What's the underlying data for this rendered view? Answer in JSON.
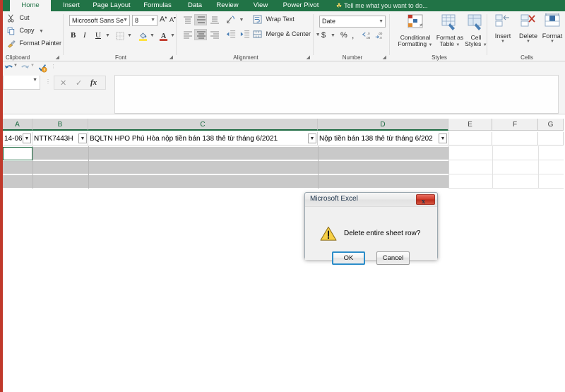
{
  "window": {
    "app_name": "Microsoft Excel"
  },
  "ribbon": {
    "tabs": [
      {
        "label": "Home",
        "active": true
      },
      {
        "label": "Insert",
        "active": false
      },
      {
        "label": "Page Layout",
        "active": false
      },
      {
        "label": "Formulas",
        "active": false
      },
      {
        "label": "Data",
        "active": false
      },
      {
        "label": "Review",
        "active": false
      },
      {
        "label": "View",
        "active": false
      },
      {
        "label": "Power Pivot",
        "active": false
      }
    ],
    "tell_me": "Tell me what you want to do...",
    "groups": {
      "clipboard": {
        "label": "Clipboard",
        "cut": "Cut",
        "copy": "Copy",
        "format_painter": "Format Painter"
      },
      "font": {
        "label": "Font",
        "font_name": "Microsoft Sans Se",
        "font_size": "8",
        "bold": "B",
        "italic": "I",
        "underline": "U",
        "grow_font": "A",
        "shrink_font": "A"
      },
      "alignment": {
        "label": "Alignment",
        "wrap_text": "Wrap Text",
        "merge_center": "Merge & Center"
      },
      "number": {
        "label": "Number",
        "format_value": "Date",
        "currency": "$",
        "percent": "%",
        "comma": ","
      },
      "styles": {
        "label": "Styles",
        "conditional_formatting": "Conditional\nFormatting",
        "conditional_formatting_l1": "Conditional",
        "conditional_formatting_l2": "Formatting",
        "format_as_table_l1": "Format as",
        "format_as_table_l2": "Table",
        "cell_styles_l1": "Cell",
        "cell_styles_l2": "Styles"
      },
      "cells": {
        "label": "Cells",
        "insert": "Insert",
        "delete": "Delete",
        "format": "Format"
      }
    }
  },
  "formula_bar": {
    "name_box_value": "",
    "formula_value": "",
    "cancel_icon": "cancel-icon",
    "enter_icon": "enter-icon",
    "fx_label": "fx"
  },
  "sheet": {
    "columns": [
      {
        "label": "A",
        "selected": true
      },
      {
        "label": "B",
        "selected": true
      },
      {
        "label": "C",
        "selected": true
      },
      {
        "label": "D",
        "selected": true
      },
      {
        "label": "E",
        "selected": false
      },
      {
        "label": "F",
        "selected": false
      },
      {
        "label": "G",
        "selected": false
      }
    ],
    "header_row": {
      "a": "14-06-",
      "b": "NTTK7443H",
      "c": "BQLTN HPO Phú Hòa nộp tiền bán 138 thẻ từ tháng 6/2021",
      "d": "Nộp tiền bán 138 thẻ từ tháng 6/202"
    }
  },
  "dialog": {
    "title": "Microsoft Excel",
    "close_label": "x",
    "message": "Delete entire sheet row?",
    "ok_label": "OK",
    "cancel_label": "Cancel",
    "warning_icon": "warning-triangle-icon"
  },
  "colors": {
    "excel_green": "#217346",
    "accent_red": "#c0392b",
    "selection_gray": "#c9c9c9",
    "focus_blue": "#2c8dc9"
  }
}
